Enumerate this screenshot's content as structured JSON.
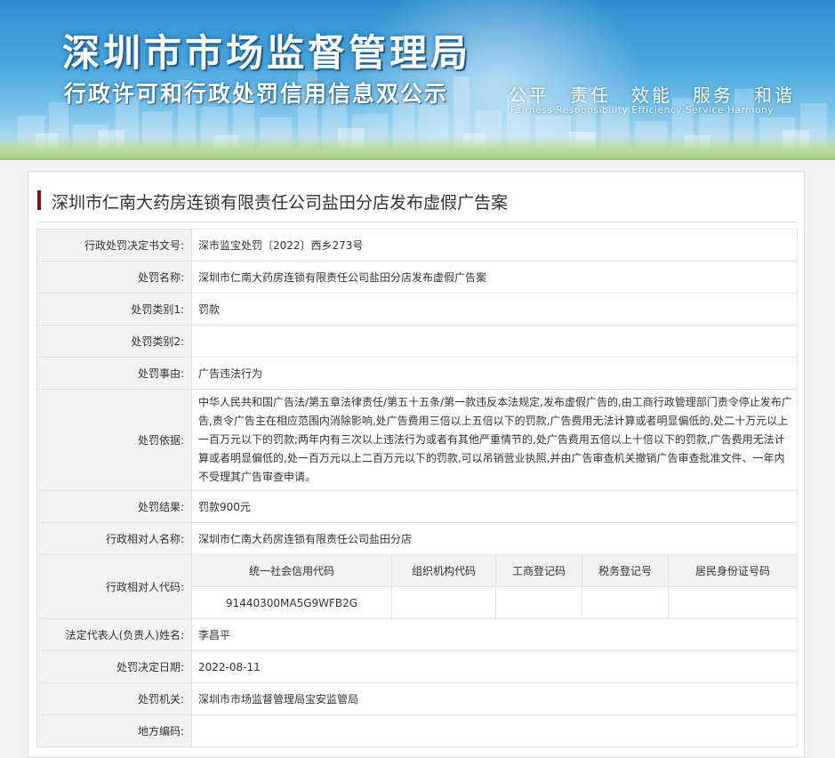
{
  "header": {
    "title": "深圳市市场监督管理局",
    "subtitle": "行政许可和行政处罚信用信息双公示",
    "slogan": "公平　责任　效能　服务　和谐",
    "slogan_en": "Fairness Responsibility Efficiency Service Harmony"
  },
  "case": {
    "title": "深圳市仁南大药房连锁有限责任公司盐田分店发布虚假广告案"
  },
  "fields": {
    "doc_no": {
      "label": "行政处罚决定书文号:",
      "value": "深市监宝处罚〔2022〕西乡273号"
    },
    "name": {
      "label": "处罚名称:",
      "value": "深圳市仁南大药房连锁有限责任公司盐田分店发布虚假广告案"
    },
    "type1": {
      "label": "处罚类别1:",
      "value": "罚款"
    },
    "type2": {
      "label": "处罚类别2:",
      "value": ""
    },
    "reason": {
      "label": "处罚事由:",
      "value": "广告违法行为"
    },
    "basis": {
      "label": "处罚依据:",
      "value": "中华人民共和国广告法/第五章法律责任/第五十五条/第一款违反本法规定,发布虚假广告的,由工商行政管理部门责令停止发布广告,责令广告主在相应范围内消除影响,处广告费用三倍以上五倍以下的罚款,广告费用无法计算或者明显偏低的,处二十万元以上一百万元以下的罚款;两年内有三次以上违法行为或者有其他严重情节的,处广告费用五倍以上十倍以下的罚款,广告费用无法计算或者明显偏低的,处一百万元以上二百万元以下的罚款,可以吊销营业执照,并由广告审查机关撤销广告审查批准文件、一年内不受理其广告审查申请。"
    },
    "result": {
      "label": "处罚结果:",
      "value": "罚款900元"
    },
    "party_name": {
      "label": "行政相对人名称:",
      "value": "深圳市仁南大药房连锁有限责任公司盐田分店"
    },
    "party_code": {
      "label": "行政相对人代码:",
      "headers": [
        "统一社会信用代码",
        "组织机构代码",
        "工商登记码",
        "税务登记号",
        "居民身份证号码"
      ],
      "values": [
        "91440300MA5G9WFB2G",
        "",
        "",
        "",
        ""
      ]
    },
    "legal_rep": {
      "label": "法定代表人(负责人)姓名:",
      "value": "李昌平"
    },
    "date": {
      "label": "处罚决定日期:",
      "value": "2022-08-11"
    },
    "authority": {
      "label": "处罚机关:",
      "value": "深圳市市场监督管理局宝安监管局"
    },
    "area_code": {
      "label": "地方编码:",
      "value": ""
    }
  }
}
